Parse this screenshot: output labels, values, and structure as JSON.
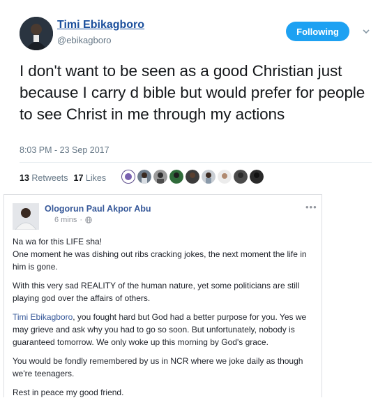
{
  "tweet": {
    "display_name": "Timi Ebikagboro",
    "handle": "@ebikagboro",
    "follow_label": "Following",
    "text": "I don't want to be seen as a good Christian just because I carry d bible but would prefer for people to see Christ in me through my actions",
    "timestamp": "8:03 PM - 23 Sep 2017",
    "retweets_count": "13",
    "retweets_label": "Retweets",
    "likes_count": "17",
    "likes_label": "Likes",
    "accent_color": "#1da1f2"
  },
  "facebook_post": {
    "author": "Ologorun Paul Akpor Abu",
    "time": "6 mins",
    "privacy_icon": "globe-icon",
    "more_label": "•••",
    "p1_line1": "Na wa for this LIFE sha!",
    "p1_line2": "One moment he was dishing out ribs cracking jokes, the next moment the life in him is gone.",
    "p2": "With this very sad REALITY of the human nature, yet some politicians are still playing god over the affairs of others.",
    "p3_tag": "Timi Ebikagboro",
    "p3_rest": ", you fought hard but God had a better purpose for you. Yes we may grieve and ask why you had to go so soon. But unfortunately, nobody is guaranteed tomorrow. We only woke up this morning by God's grace.",
    "p4": "You would be fondly remembered by us in NCR where we joke daily as though we're teenagers.",
    "p5": "Rest in peace my good friend.",
    "link_color": "#365899"
  }
}
